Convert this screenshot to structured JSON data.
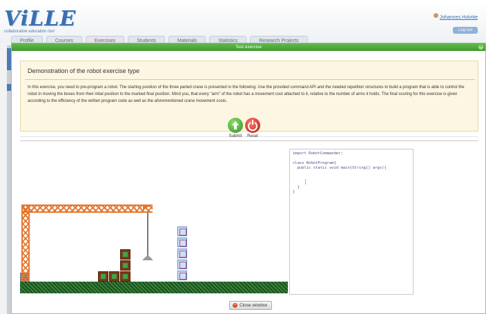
{
  "app": {
    "logo_text": "ViLLE",
    "logo_tagline": "collaborative education tool"
  },
  "user": {
    "name": "Johannes Holvitie",
    "logout_label": "Log out"
  },
  "nav": {
    "tabs": [
      {
        "label": "Profile",
        "icon": "profile-icon"
      },
      {
        "label": "Courses",
        "icon": "courses-icon"
      },
      {
        "label": "Exercises",
        "icon": "exercises-icon",
        "active": true
      },
      {
        "label": "Students",
        "icon": "students-icon"
      },
      {
        "label": "Materials",
        "icon": "materials-icon"
      },
      {
        "label": "Statistics",
        "icon": "statistics-icon"
      },
      {
        "label": "Research Projects",
        "icon": "research-projects-icon"
      }
    ]
  },
  "dialog": {
    "title": "Test exercise",
    "description_title": "Demonstration of the robot exercise type",
    "description_text": "In this exercise, you need to pre-program a robot. The starting position of the three parted crane is presented in the following. Use the provided command API and the needed repetition structures to build a program that is able to control the robot in moving the boxes from their inital position to the marked final position. Mind you, that every \"arm\" of the robot has a movement cost attached to it, relative to the number of arms it holds. The final scoring for this exercise is given according to the efficiency of the written program code as well as the aforementioned crane movement costs.",
    "submit_label": "Submit",
    "reset_label": "Reset",
    "close_label": "Close window"
  },
  "code": {
    "lines": [
      "import RobotCommander;",
      "",
      "class RobotProgram{",
      "  public static void main(String[] args){",
      "",
      "  ",
      "",
      "  }",
      "}"
    ]
  },
  "colors": {
    "title_bar": "#3f9a2e",
    "crane": "#e4762f",
    "crate": "#7a3b17",
    "target": "#cde0f5",
    "ground": "#1d4f23",
    "accent": "#3a6fb0"
  }
}
